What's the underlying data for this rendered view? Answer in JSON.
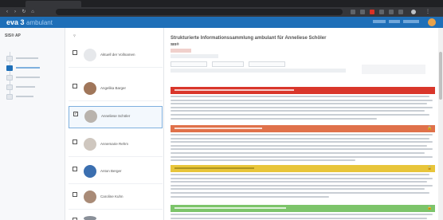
{
  "header": {
    "logo_main": "eva 3",
    "logo_sub": "ambulant",
    "colors": {
      "primary": "#1e6fb8"
    }
  },
  "leftnav": {
    "title": "SIS® AP"
  },
  "patients": [
    {
      "name": "Aktuell der Vollnamen",
      "selected": false
    },
    {
      "name": "Angelika Barger",
      "selected": false
    },
    {
      "name": "Anneliese Schöler",
      "selected": true
    },
    {
      "name": "Annemarie Rehm",
      "selected": false
    },
    {
      "name": "Anton Berger",
      "selected": false
    },
    {
      "name": "Caroline Kuhn",
      "selected": false
    }
  ],
  "main": {
    "title": "Strukturierte Informationssammlung ambulant für Anneliese Schöler",
    "meta_header": "SIS®",
    "sections": [
      {
        "color": "#d9362b",
        "icon": "lock-icon"
      },
      {
        "color": "#e0714a",
        "icon": "lock-icon"
      },
      {
        "color": "#e8c53a",
        "icon": "lock-icon"
      },
      {
        "color": "#7cc46a",
        "icon": "lock-icon"
      }
    ]
  }
}
